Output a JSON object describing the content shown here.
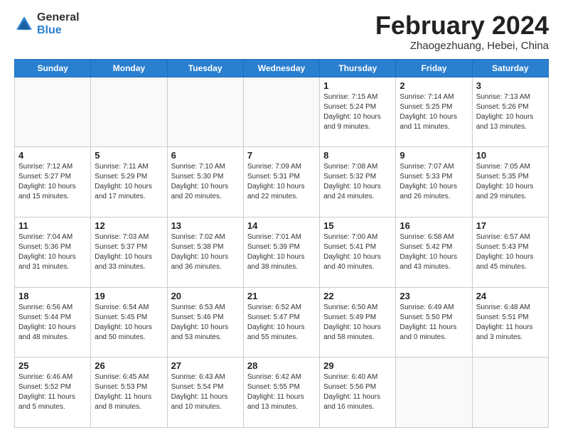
{
  "logo": {
    "general": "General",
    "blue": "Blue"
  },
  "header": {
    "month": "February 2024",
    "location": "Zhaogezhuang, Hebei, China"
  },
  "weekdays": [
    "Sunday",
    "Monday",
    "Tuesday",
    "Wednesday",
    "Thursday",
    "Friday",
    "Saturday"
  ],
  "weeks": [
    [
      {
        "day": "",
        "info": ""
      },
      {
        "day": "",
        "info": ""
      },
      {
        "day": "",
        "info": ""
      },
      {
        "day": "",
        "info": ""
      },
      {
        "day": "1",
        "info": "Sunrise: 7:15 AM\nSunset: 5:24 PM\nDaylight: 10 hours\nand 9 minutes."
      },
      {
        "day": "2",
        "info": "Sunrise: 7:14 AM\nSunset: 5:25 PM\nDaylight: 10 hours\nand 11 minutes."
      },
      {
        "day": "3",
        "info": "Sunrise: 7:13 AM\nSunset: 5:26 PM\nDaylight: 10 hours\nand 13 minutes."
      }
    ],
    [
      {
        "day": "4",
        "info": "Sunrise: 7:12 AM\nSunset: 5:27 PM\nDaylight: 10 hours\nand 15 minutes."
      },
      {
        "day": "5",
        "info": "Sunrise: 7:11 AM\nSunset: 5:29 PM\nDaylight: 10 hours\nand 17 minutes."
      },
      {
        "day": "6",
        "info": "Sunrise: 7:10 AM\nSunset: 5:30 PM\nDaylight: 10 hours\nand 20 minutes."
      },
      {
        "day": "7",
        "info": "Sunrise: 7:09 AM\nSunset: 5:31 PM\nDaylight: 10 hours\nand 22 minutes."
      },
      {
        "day": "8",
        "info": "Sunrise: 7:08 AM\nSunset: 5:32 PM\nDaylight: 10 hours\nand 24 minutes."
      },
      {
        "day": "9",
        "info": "Sunrise: 7:07 AM\nSunset: 5:33 PM\nDaylight: 10 hours\nand 26 minutes."
      },
      {
        "day": "10",
        "info": "Sunrise: 7:05 AM\nSunset: 5:35 PM\nDaylight: 10 hours\nand 29 minutes."
      }
    ],
    [
      {
        "day": "11",
        "info": "Sunrise: 7:04 AM\nSunset: 5:36 PM\nDaylight: 10 hours\nand 31 minutes."
      },
      {
        "day": "12",
        "info": "Sunrise: 7:03 AM\nSunset: 5:37 PM\nDaylight: 10 hours\nand 33 minutes."
      },
      {
        "day": "13",
        "info": "Sunrise: 7:02 AM\nSunset: 5:38 PM\nDaylight: 10 hours\nand 36 minutes."
      },
      {
        "day": "14",
        "info": "Sunrise: 7:01 AM\nSunset: 5:39 PM\nDaylight: 10 hours\nand 38 minutes."
      },
      {
        "day": "15",
        "info": "Sunrise: 7:00 AM\nSunset: 5:41 PM\nDaylight: 10 hours\nand 40 minutes."
      },
      {
        "day": "16",
        "info": "Sunrise: 6:58 AM\nSunset: 5:42 PM\nDaylight: 10 hours\nand 43 minutes."
      },
      {
        "day": "17",
        "info": "Sunrise: 6:57 AM\nSunset: 5:43 PM\nDaylight: 10 hours\nand 45 minutes."
      }
    ],
    [
      {
        "day": "18",
        "info": "Sunrise: 6:56 AM\nSunset: 5:44 PM\nDaylight: 10 hours\nand 48 minutes."
      },
      {
        "day": "19",
        "info": "Sunrise: 6:54 AM\nSunset: 5:45 PM\nDaylight: 10 hours\nand 50 minutes."
      },
      {
        "day": "20",
        "info": "Sunrise: 6:53 AM\nSunset: 5:46 PM\nDaylight: 10 hours\nand 53 minutes."
      },
      {
        "day": "21",
        "info": "Sunrise: 6:52 AM\nSunset: 5:47 PM\nDaylight: 10 hours\nand 55 minutes."
      },
      {
        "day": "22",
        "info": "Sunrise: 6:50 AM\nSunset: 5:49 PM\nDaylight: 10 hours\nand 58 minutes."
      },
      {
        "day": "23",
        "info": "Sunrise: 6:49 AM\nSunset: 5:50 PM\nDaylight: 11 hours\nand 0 minutes."
      },
      {
        "day": "24",
        "info": "Sunrise: 6:48 AM\nSunset: 5:51 PM\nDaylight: 11 hours\nand 3 minutes."
      }
    ],
    [
      {
        "day": "25",
        "info": "Sunrise: 6:46 AM\nSunset: 5:52 PM\nDaylight: 11 hours\nand 5 minutes."
      },
      {
        "day": "26",
        "info": "Sunrise: 6:45 AM\nSunset: 5:53 PM\nDaylight: 11 hours\nand 8 minutes."
      },
      {
        "day": "27",
        "info": "Sunrise: 6:43 AM\nSunset: 5:54 PM\nDaylight: 11 hours\nand 10 minutes."
      },
      {
        "day": "28",
        "info": "Sunrise: 6:42 AM\nSunset: 5:55 PM\nDaylight: 11 hours\nand 13 minutes."
      },
      {
        "day": "29",
        "info": "Sunrise: 6:40 AM\nSunset: 5:56 PM\nDaylight: 11 hours\nand 16 minutes."
      },
      {
        "day": "",
        "info": ""
      },
      {
        "day": "",
        "info": ""
      }
    ]
  ]
}
